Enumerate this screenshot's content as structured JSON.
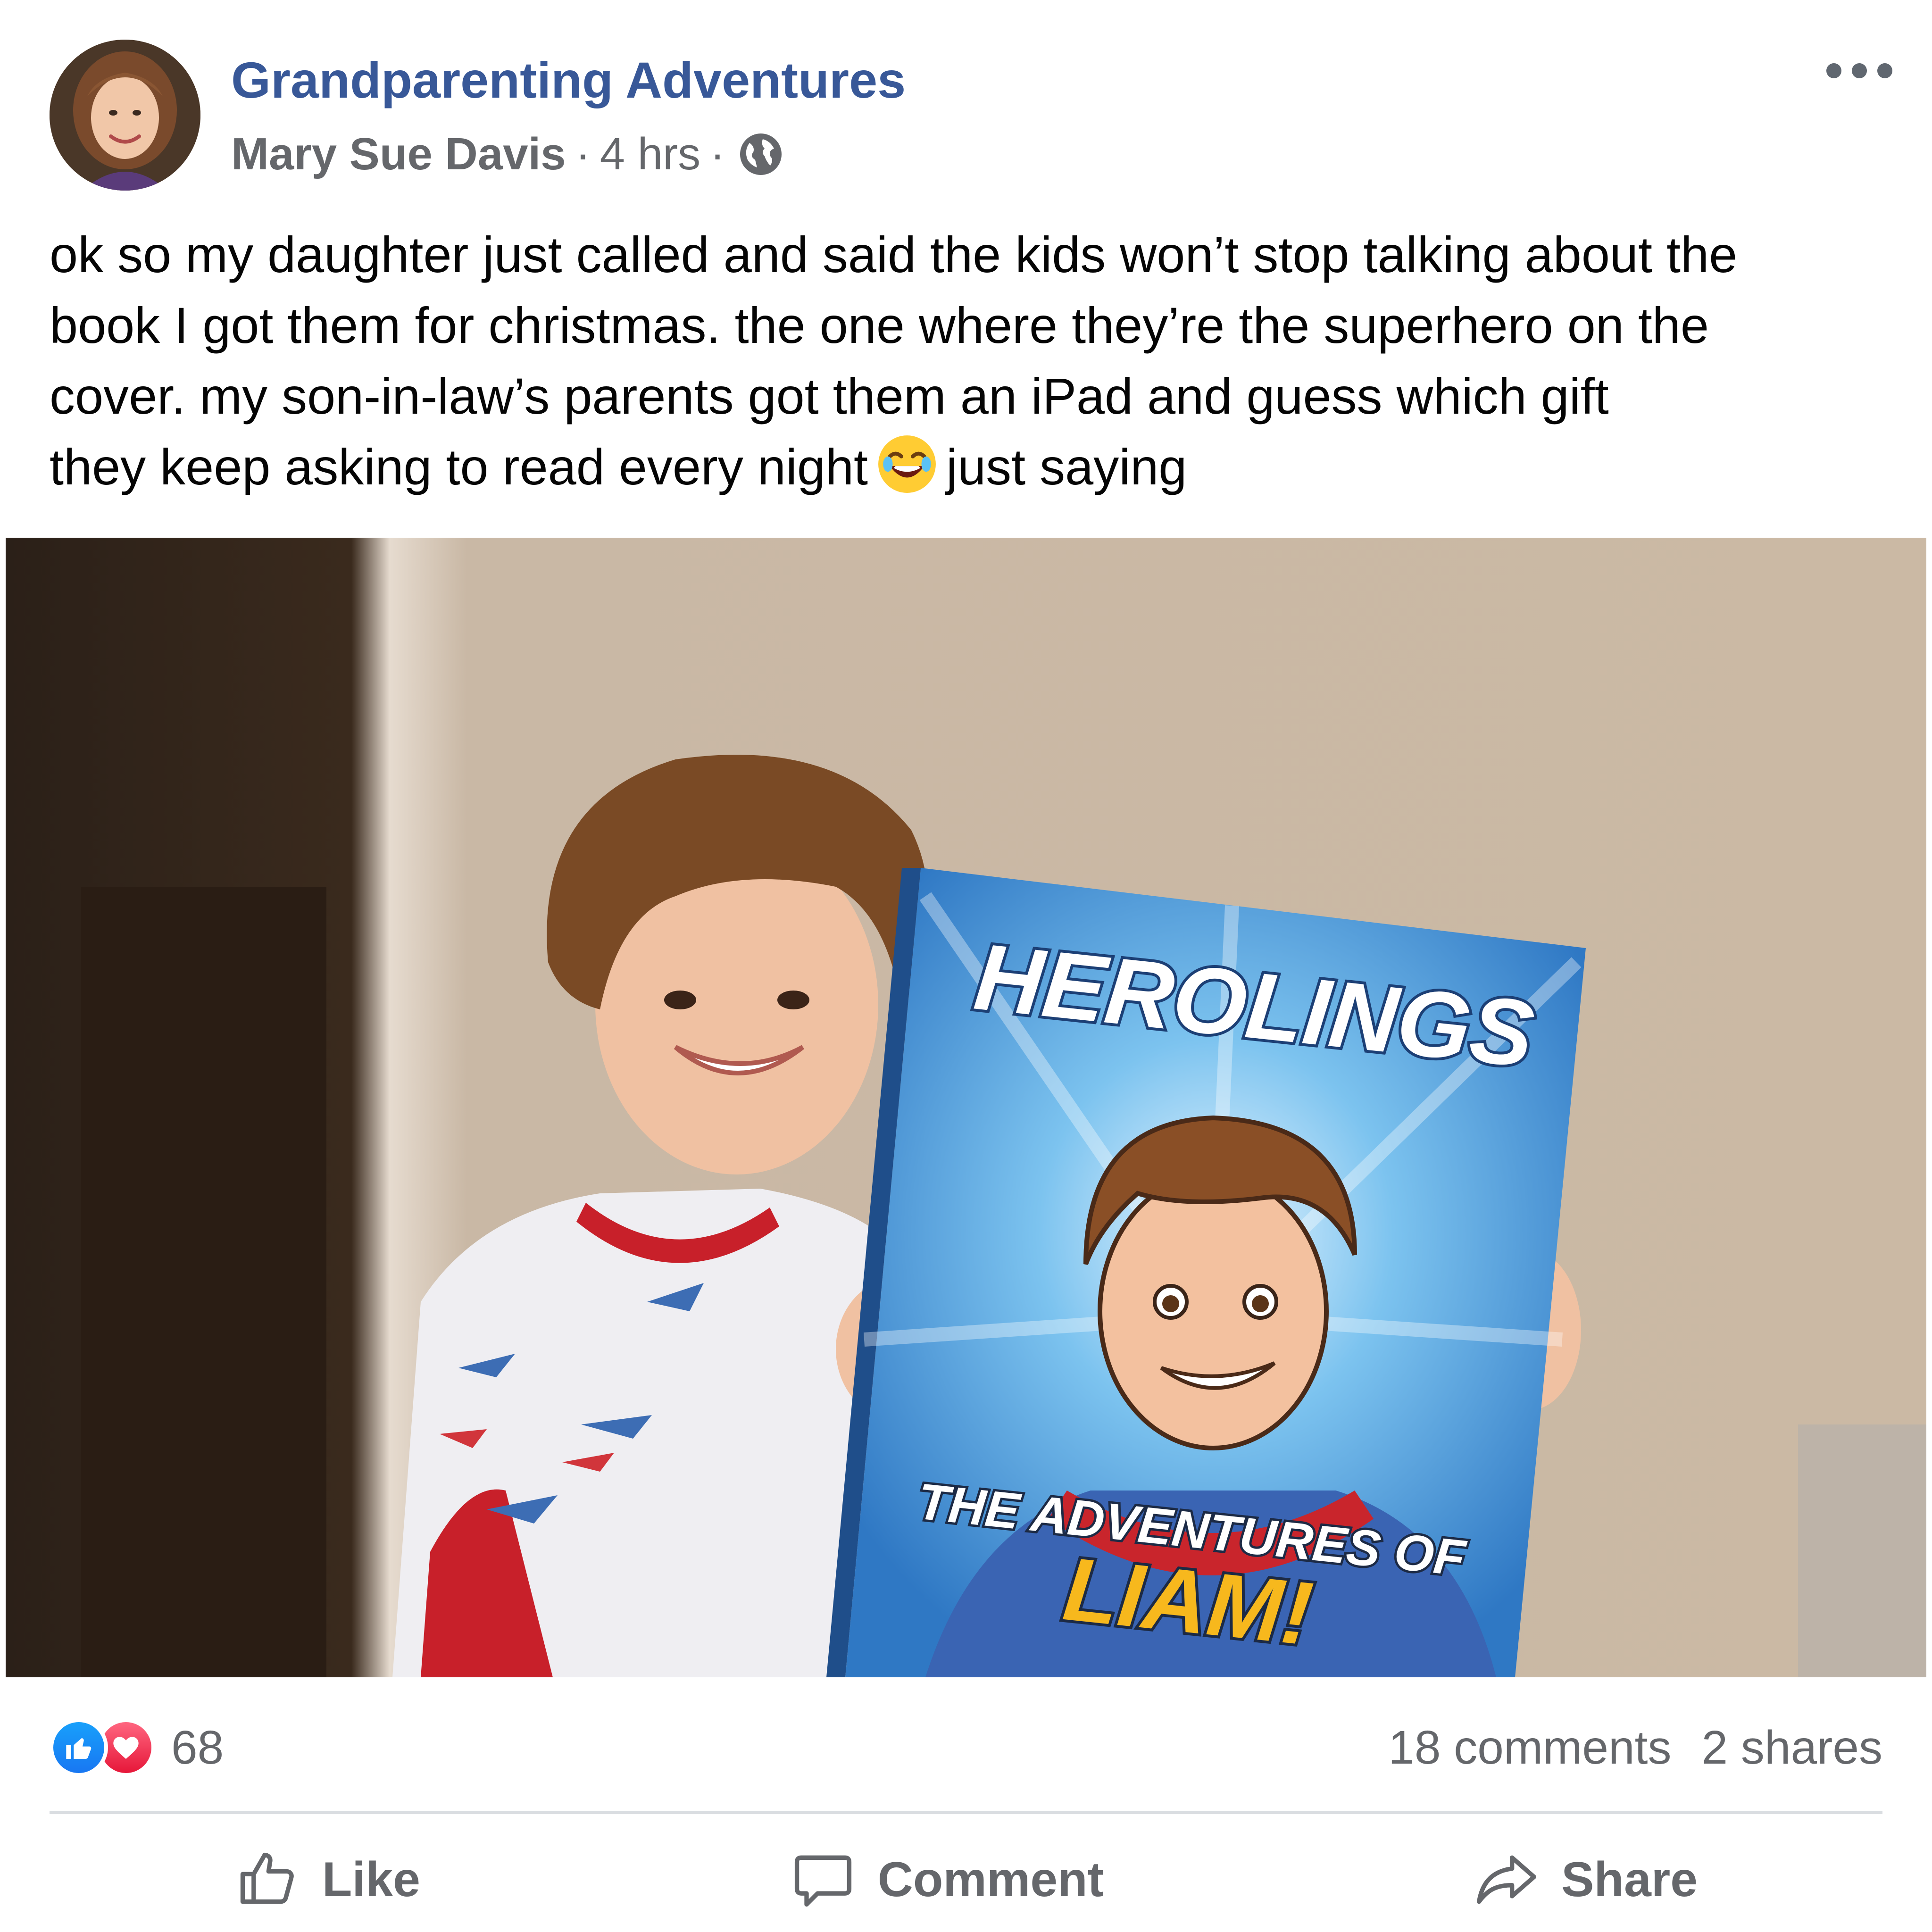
{
  "post": {
    "group_name": "Grandparenting Adventures",
    "author": "Mary Sue Davis",
    "separator": "·",
    "time": "4 hrs",
    "audience_icon": "globe-icon",
    "menu_icon": "more-options-icon",
    "text_lines": [
      "ok so my daughter just called and said the kids won’t stop talking about the",
      "book I got them for christmas. the one where they’re the superhero on the",
      "cover. my son-in-law’s parents got them an iPad and guess which gift",
      "they keep asking to read every night"
    ],
    "emoji": "😂",
    "text_tail": "just saying"
  },
  "photo": {
    "book_title": "HEROLINGS",
    "book_subtitle": "THE ADVENTURES OF",
    "book_name": "LIAM!"
  },
  "stats": {
    "reaction_count": "68",
    "comments": "18 comments",
    "shares": "2 shares"
  },
  "actions": {
    "like": "Like",
    "comment": "Comment",
    "share": "Share"
  },
  "colors": {
    "group_blue": "#385898",
    "meta_gray": "#65676b",
    "like_blue": "#1877f2",
    "love_red": "#e61739"
  }
}
